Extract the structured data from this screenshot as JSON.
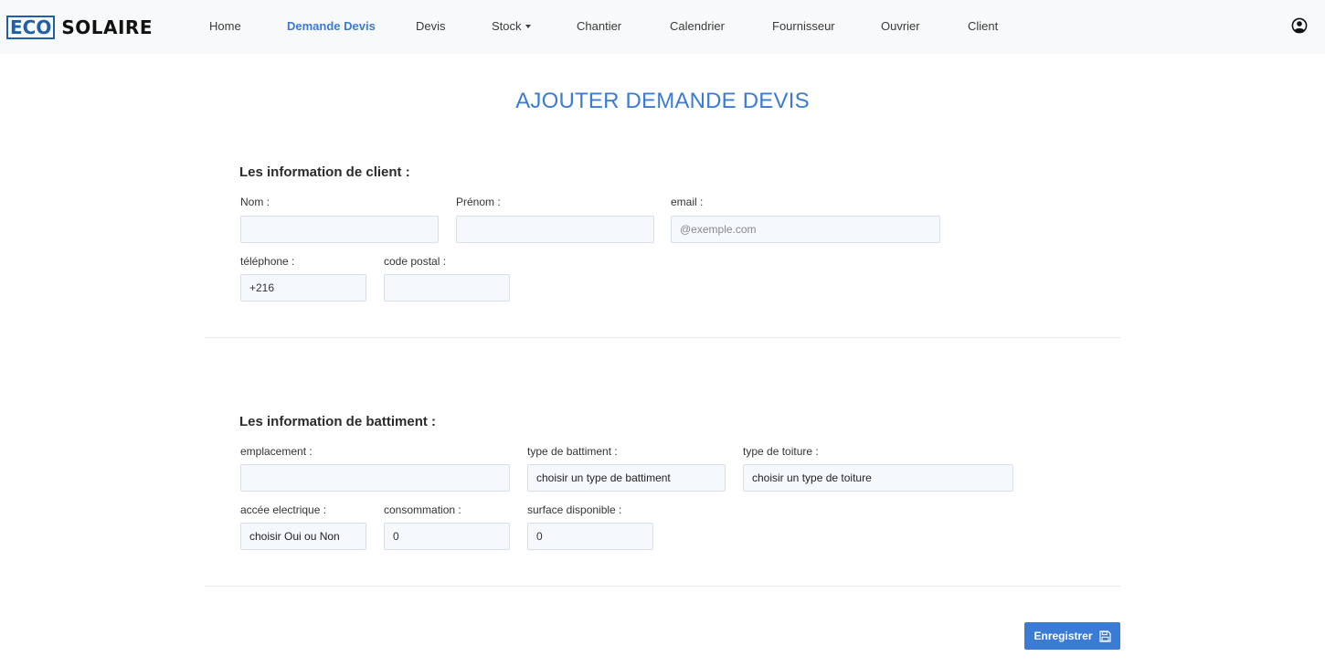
{
  "brand": {
    "eco": "ECO",
    "solaire": "SOLAIRE"
  },
  "nav": {
    "items": [
      {
        "label": "Home"
      },
      {
        "label": "Demande Devis",
        "active": true
      },
      {
        "label": "Devis"
      },
      {
        "label": "Stock",
        "dropdown": true
      },
      {
        "label": "Chantier"
      },
      {
        "label": "Calendrier"
      },
      {
        "label": "Fournisseur"
      },
      {
        "label": "Ouvrier"
      },
      {
        "label": "Client"
      }
    ],
    "user_icon": "user-circle-icon"
  },
  "page": {
    "title": "AJOUTER DEMANDE DEVIS"
  },
  "client": {
    "heading": "Les information de client :",
    "nom_label": "Nom :",
    "prenom_label": "Prénom :",
    "email_label": "email :",
    "email_placeholder": "@exemple.com",
    "telephone_label": "téléphone :",
    "telephone_value": "+216",
    "code_postal_label": "code postal :"
  },
  "batiment": {
    "heading": "Les information de battiment :",
    "emplacement_label": "emplacement :",
    "type_batiment_label": "type de battiment :",
    "type_batiment_value": "choisir un type de battiment",
    "type_toiture_label": "type de toiture :",
    "type_toiture_value": "choisir un type de toiture",
    "acces_label": "accée electrique :",
    "acces_value": "choisir Oui ou Non",
    "consommation_label": "consommation :",
    "consommation_value": "0",
    "surface_label": "surface disponible :",
    "surface_value": "0"
  },
  "actions": {
    "save_label": "Enregistrer",
    "save_icon": "floppy-disk-icon"
  },
  "colors": {
    "accent": "#3a7bd5",
    "brand_border": "#1f5fa8",
    "navbar_bg": "#f8f9fa",
    "field_bg": "#f5f8fd"
  }
}
